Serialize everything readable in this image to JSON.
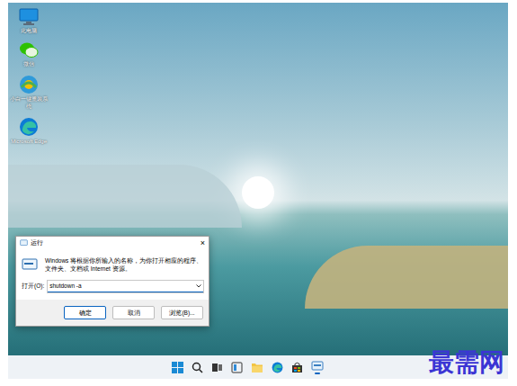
{
  "desktop_icons": [
    {
      "label": "此电脑",
      "kind": "pc"
    },
    {
      "label": "微信",
      "kind": "wechat"
    },
    {
      "label": "小白一键重装系统",
      "kind": "xiaobai"
    },
    {
      "label": "Microsoft Edge",
      "kind": "edge"
    }
  ],
  "run_dialog": {
    "title": "运行",
    "close": "×",
    "description": "Windows 将根据你所输入的名称，为你打开相应的程序、文件夹、文档或 Internet 资源。",
    "open_label": "打开(O):",
    "input_value": "shutdown -a",
    "buttons": [
      {
        "label": "确定",
        "default": true
      },
      {
        "label": "取消",
        "default": false
      },
      {
        "label": "浏览(B)...",
        "default": false
      }
    ]
  },
  "watermark": "最需网"
}
